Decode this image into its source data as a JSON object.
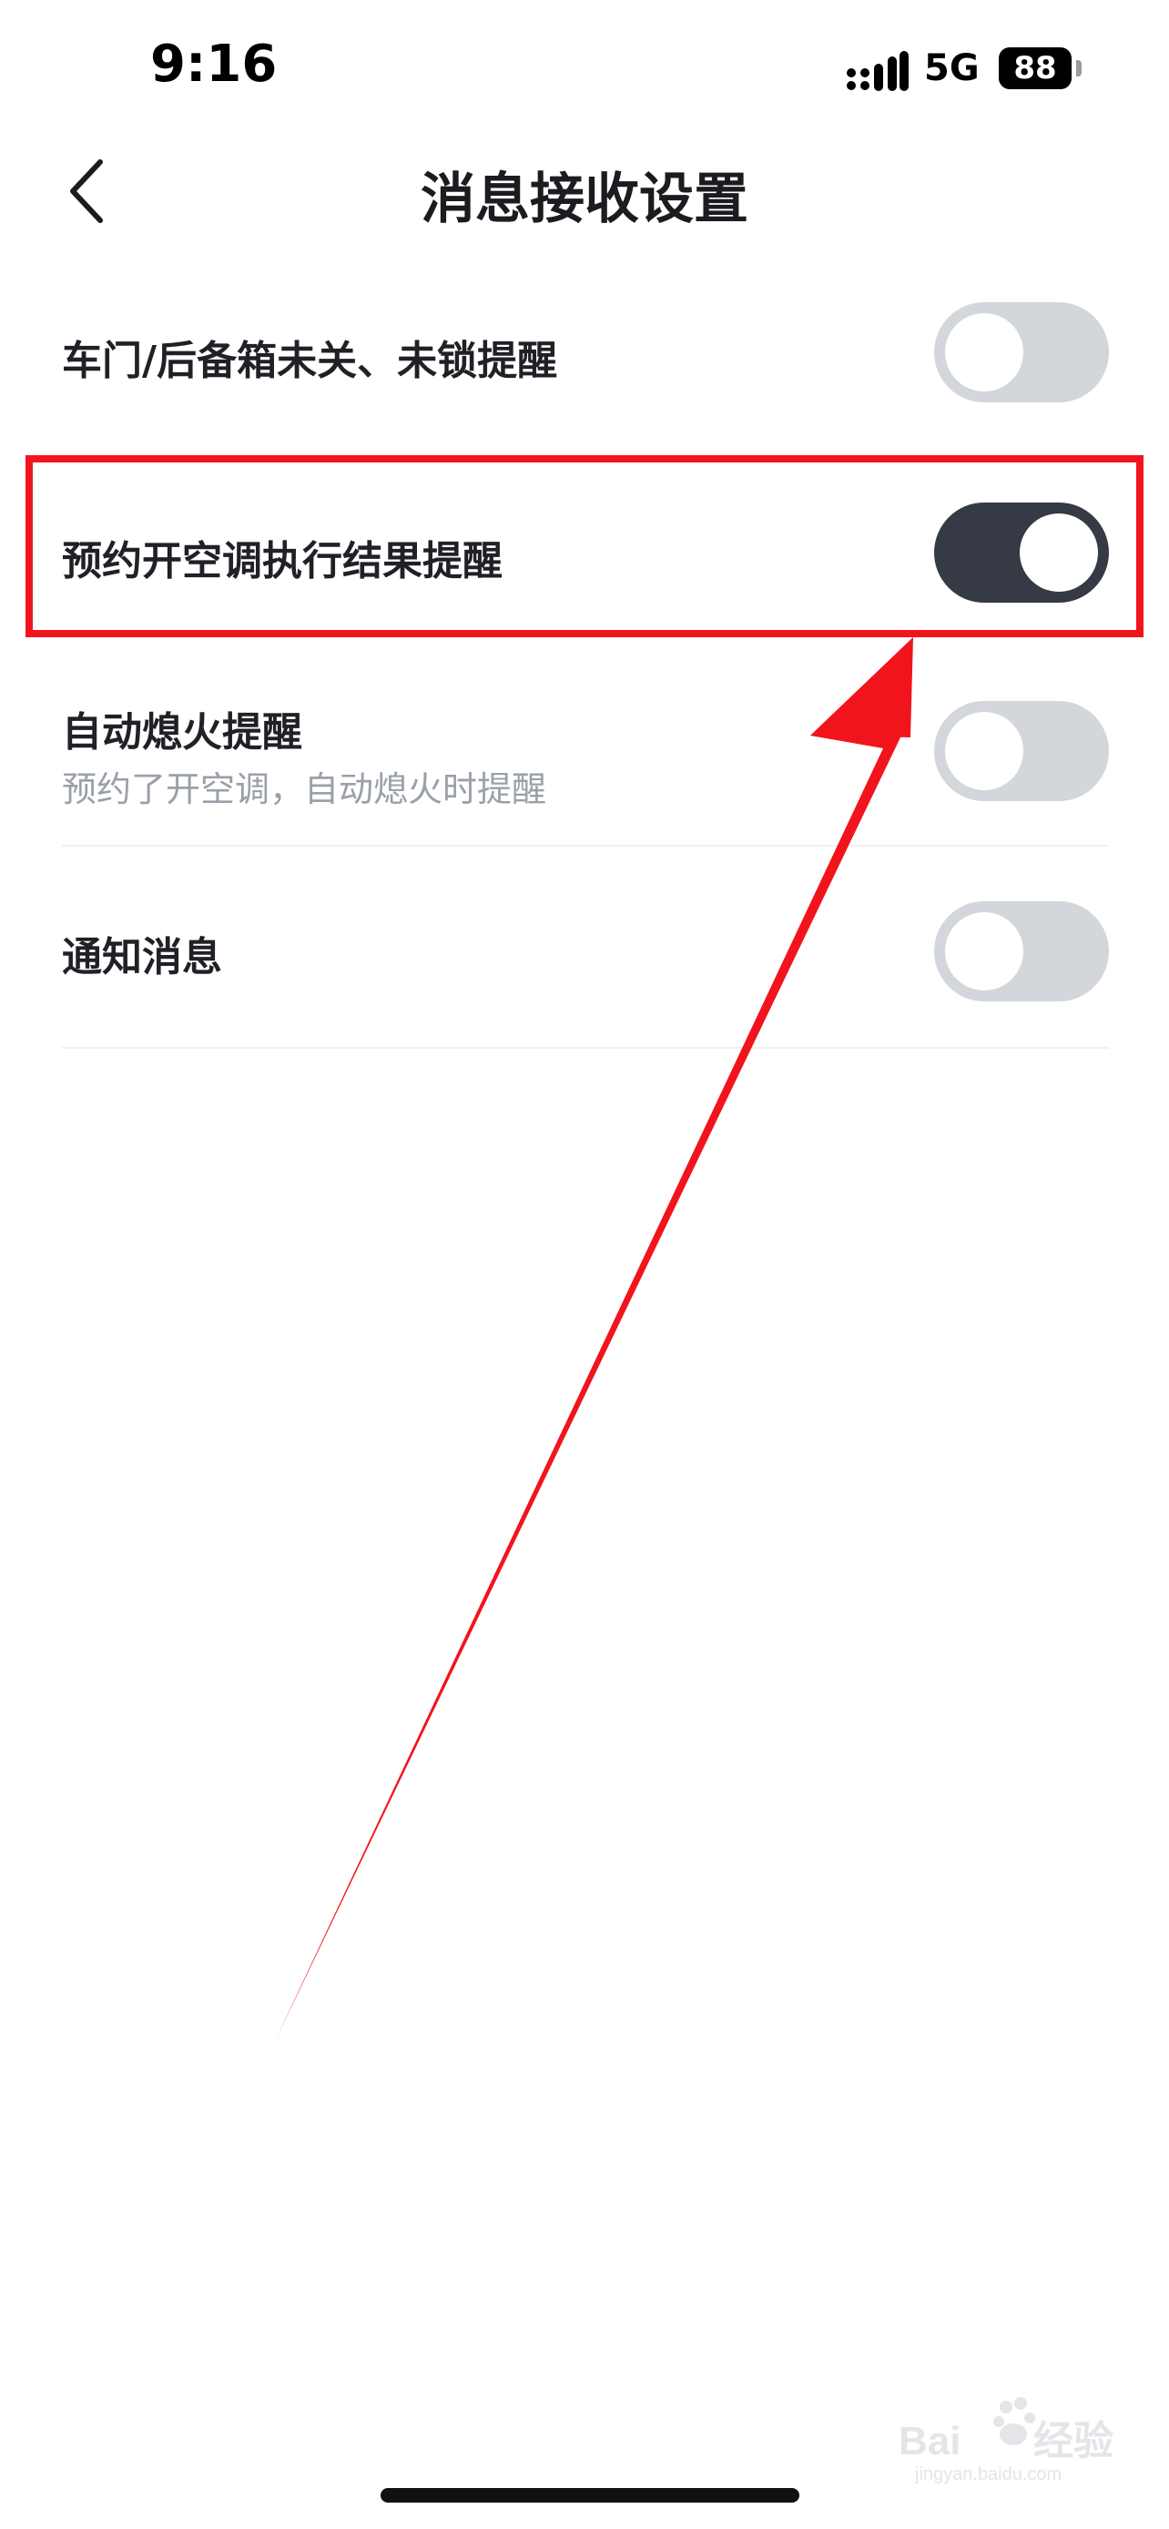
{
  "status_bar": {
    "time": "9:16",
    "network": "5G",
    "battery": "88",
    "signal_icon": "cellular-signal-icon"
  },
  "nav": {
    "back_icon": "chevron-left-icon",
    "title": "消息接收设置"
  },
  "settings": [
    {
      "label": "车门/后备箱未关、未锁提醒",
      "description": "",
      "enabled": false
    },
    {
      "label": "预约开空调执行结果提醒",
      "description": "",
      "enabled": true
    },
    {
      "label": "自动熄火提醒",
      "description": "预约了开空调，自动熄火时提醒",
      "enabled": false
    },
    {
      "label": "通知消息",
      "description": "",
      "enabled": false
    }
  ],
  "annotation": {
    "color": "#f2141c"
  },
  "watermark": {
    "text": "Baidu 经验",
    "subtext": "jingyan.baidu.com"
  }
}
